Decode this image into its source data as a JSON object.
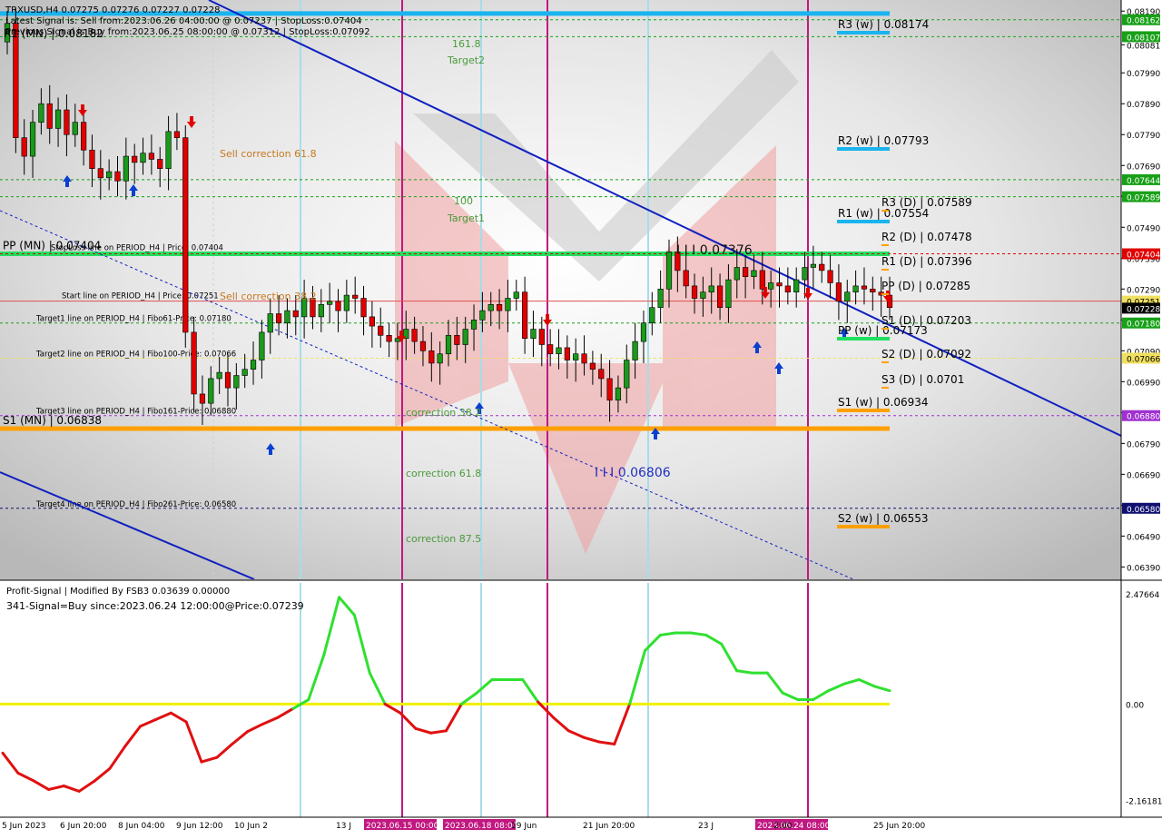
{
  "chart_data": [
    {
      "type": "candlestick",
      "symbol": "TRXUSD",
      "timeframe": "H4",
      "header": {
        "symbol_line": "TRXUSD,H4  0.07275 0.07276 0.07227 0.07228",
        "latest_signal": "Latest Signal is: Sell from:2023.06.26 04:00:00 @ 0.07237 | StopLoss:0.07404",
        "previous_signal": "Previous Signal is Buy from:2023.06.25 08:00:00 @ 0.07312 | StopLoss:0.07092",
        "r1_mn": "R1 (MN) | 0.08182"
      },
      "ylim": [
        0.0635,
        0.0822
      ],
      "price_axis_labels": [
        "0.08190",
        "0.08081",
        "0.07990",
        "0.07890",
        "0.07790",
        "0.07690",
        "0.07590",
        "0.07490",
        "0.07390",
        "0.07290",
        "0.07190",
        "0.07090",
        "0.06990",
        "0.06890",
        "0.06790",
        "0.06690",
        "0.06590",
        "0.06490",
        "0.06390"
      ],
      "price_tags": [
        {
          "text": "0.08162",
          "value": 0.08162,
          "color": "#18a018"
        },
        {
          "text": "0.08107",
          "value": 0.08107,
          "color": "#18a018"
        },
        {
          "text": "0.07644",
          "value": 0.07644,
          "color": "#18a018"
        },
        {
          "text": "0.07589",
          "value": 0.07589,
          "color": "#18a018"
        },
        {
          "text": "0.07404",
          "value": 0.07404,
          "color": "#e00000"
        },
        {
          "text": "0.07251",
          "value": 0.07251,
          "color": "#f0e060"
        },
        {
          "text": "0.07228",
          "value": 0.07228,
          "color": "#000000"
        },
        {
          "text": "0.07180",
          "value": 0.0718,
          "color": "#18a018"
        },
        {
          "text": "0.07066",
          "value": 0.07066,
          "color": "#f0e060"
        },
        {
          "text": "0.06880",
          "value": 0.0688,
          "color": "#a030d0"
        },
        {
          "text": "0.06580",
          "value": 0.0658,
          "color": "#101070"
        }
      ],
      "time_labels": [
        "5 Jun 2023",
        "6 Jun 20:00",
        "8 Jun 04:00",
        "9 Jun 12:00",
        "10 Jun 2",
        "13 J",
        "2023.06.15 00:00",
        "2023.06.18 08:00",
        "19 Jun",
        "21 Jun 20:00",
        "23 J",
        "2023.06.24 08:00",
        "2:00",
        "25 Jun 20:00"
      ],
      "closes": [
        0.0815,
        0.0778,
        0.0772,
        0.0783,
        0.0789,
        0.0781,
        0.0787,
        0.0779,
        0.0783,
        0.0774,
        0.0768,
        0.0765,
        0.0767,
        0.0764,
        0.0772,
        0.077,
        0.0773,
        0.0771,
        0.0768,
        0.078,
        0.0778,
        0.0715,
        0.0695,
        0.0692,
        0.07,
        0.0702,
        0.0697,
        0.0701,
        0.0703,
        0.0706,
        0.0715,
        0.0721,
        0.0718,
        0.0722,
        0.072,
        0.0726,
        0.072,
        0.0724,
        0.0725,
        0.0722,
        0.0727,
        0.0726,
        0.072,
        0.0717,
        0.0714,
        0.0712,
        0.0713,
        0.0716,
        0.0712,
        0.0709,
        0.0705,
        0.0708,
        0.0714,
        0.0711,
        0.0716,
        0.0719,
        0.0722,
        0.0724,
        0.0722,
        0.0726,
        0.0728,
        0.0713,
        0.0716,
        0.0711,
        0.0708,
        0.071,
        0.0706,
        0.0708,
        0.0705,
        0.0703,
        0.07,
        0.0693,
        0.0697,
        0.0706,
        0.0712,
        0.0718,
        0.0723,
        0.0729,
        0.0741,
        0.0735,
        0.073,
        0.0726,
        0.0728,
        0.073,
        0.0723,
        0.0732,
        0.0736,
        0.0733,
        0.0735,
        0.0729,
        0.0731,
        0.073,
        0.0728,
        0.0732,
        0.0736,
        0.0737,
        0.0735,
        0.0731,
        0.0725,
        0.0728,
        0.073,
        0.0729,
        0.0728,
        0.0727,
        0.0723
      ],
      "levels": [
        {
          "name": "pp-mn",
          "label": "PP (MN) | 0.07404",
          "value": 0.07404,
          "color": "#20e060",
          "style": "thick"
        },
        {
          "name": "s1-mn",
          "label": "S1 (MN) | 0.06838",
          "value": 0.06838,
          "color": "#ffa000",
          "style": "thick"
        },
        {
          "name": "r1-mn",
          "label": "",
          "value": 0.08182,
          "color": "#1ab4ee",
          "style": "thick"
        },
        {
          "name": "stoploss",
          "label": "StopLoss line on PERIOD_H4 | Price: 0.07404",
          "value": 0.07404,
          "color": "#e00000",
          "style": "dashed"
        },
        {
          "name": "start",
          "label": "Start line on PERIOD_H4 | Price: 0.07251",
          "value": 0.07251,
          "color": "#e05050",
          "style": "solid"
        },
        {
          "name": "target1",
          "label": "Target1 line on PERIOD_H4 | Fibo61-Price: 0.07180",
          "value": 0.0718,
          "color": "#18a018",
          "style": "dashed"
        },
        {
          "name": "target2",
          "label": "Target2 line on PERIOD_H4 | Fibo100-Price: 0.07066",
          "value": 0.07066,
          "color": "#f0e060",
          "style": "dashed"
        },
        {
          "name": "target3",
          "label": "Target3 line on PERIOD_H4 | Fibo161-Price: 0.06880",
          "value": 0.0688,
          "color": "#a030d0",
          "style": "dashed"
        },
        {
          "name": "target4",
          "label": "Target4 line on PERIOD_H4 | Fibo261-Price: 0.06580",
          "value": 0.0658,
          "color": "#101070",
          "style": "dashed"
        },
        {
          "name": "level-81",
          "label": "",
          "value": 0.08162,
          "color": "#18a018",
          "style": "dashed"
        },
        {
          "name": "level-8107",
          "label": "",
          "value": 0.08107,
          "color": "#18a018",
          "style": "dashed"
        },
        {
          "name": "level-7644",
          "label": "",
          "value": 0.07644,
          "color": "#18a018",
          "style": "dashed"
        },
        {
          "name": "level-7589",
          "label": "",
          "value": 0.07589,
          "color": "#18a018",
          "style": "dashed"
        }
      ],
      "pivots_weekly": [
        {
          "label": "R3 (w) | 0.08174",
          "value": 0.08174,
          "color": "#1ab4ee"
        },
        {
          "label": "R2 (w) | 0.07793",
          "value": 0.07793,
          "color": "#1ab4ee"
        },
        {
          "label": "R1 (w) | 0.07554",
          "value": 0.07554,
          "color": "#1ab4ee"
        },
        {
          "label": "PP (w) | 0.07173",
          "value": 0.07173,
          "color": "#20e060"
        },
        {
          "label": "S1 (w) | 0.06934",
          "value": 0.06934,
          "color": "#ffa000"
        },
        {
          "label": "S2 (w) | 0.06553",
          "value": 0.06553,
          "color": "#ffa000"
        }
      ],
      "pivots_daily": [
        {
          "label": "R3 (D) | 0.07589",
          "value": 0.07589
        },
        {
          "label": "R2 (D) | 0.07478",
          "value": 0.07478
        },
        {
          "label": "R1 (D) | 0.07396",
          "value": 0.07396
        },
        {
          "label": "PP (D) | 0.07285",
          "value": 0.07285
        },
        {
          "label": "S1 (D) | 0.07203",
          "value": 0.07203
        },
        {
          "label": "S2 (D) | 0.07092",
          "value": 0.07092
        },
        {
          "label": "S3 (D) | 0.0701",
          "value": 0.0701
        }
      ],
      "annotations": [
        {
          "text": "161.8",
          "color": "#4a9a3a"
        },
        {
          "text": "Target2",
          "color": "#4a9a3a"
        },
        {
          "text": "Sell correction 61.8",
          "color": "#c87820"
        },
        {
          "text": "100",
          "color": "#4a9a3a"
        },
        {
          "text": "Target1",
          "color": "#4a9a3a"
        },
        {
          "text": "Sell correction 38.2",
          "color": "#c87820"
        },
        {
          "text": "correction 38.2",
          "color": "#4a9a3a"
        },
        {
          "text": "correction 61.8",
          "color": "#4a9a3a"
        },
        {
          "text": "correction 87.5",
          "color": "#4a9a3a"
        },
        {
          "text": "I I I 0.07376",
          "color": "#101010"
        },
        {
          "text": "I I I 0.06806",
          "color": "#2030c0"
        }
      ]
    },
    {
      "type": "line",
      "title": "Profit-Signal | Modified By FSB3 0.03639 0.00000",
      "signal_text": "341-Signal=Buy since:2023.06.24 12:00:00@Price:0.07239",
      "ylim": [
        -2.4,
        2.6
      ],
      "axis_labels": [
        "2.47664",
        "0.00",
        "-2.16181"
      ],
      "axis_values": [
        2.47664,
        0,
        -2.16181
      ],
      "baseline": 0,
      "values": [
        -1.1,
        -1.55,
        -1.72,
        -1.92,
        -1.84,
        -1.96,
        -1.73,
        -1.45,
        -0.95,
        -0.5,
        -0.35,
        -0.2,
        -0.4,
        -1.3,
        -1.2,
        -0.9,
        -0.62,
        -0.45,
        -0.3,
        -0.1,
        0.1,
        1.1,
        2.4,
        2.0,
        0.7,
        0.0,
        -0.2,
        -0.55,
        -0.65,
        -0.6,
        0.0,
        0.25,
        0.55,
        0.55,
        0.55,
        0.05,
        -0.3,
        -0.6,
        -0.75,
        -0.85,
        -0.9,
        0.0,
        1.2,
        1.55,
        1.6,
        1.6,
        1.55,
        1.35,
        0.75,
        0.7,
        0.7,
        0.25,
        0.1,
        0.1,
        0.3,
        0.45,
        0.55,
        0.4,
        0.3
      ]
    }
  ]
}
